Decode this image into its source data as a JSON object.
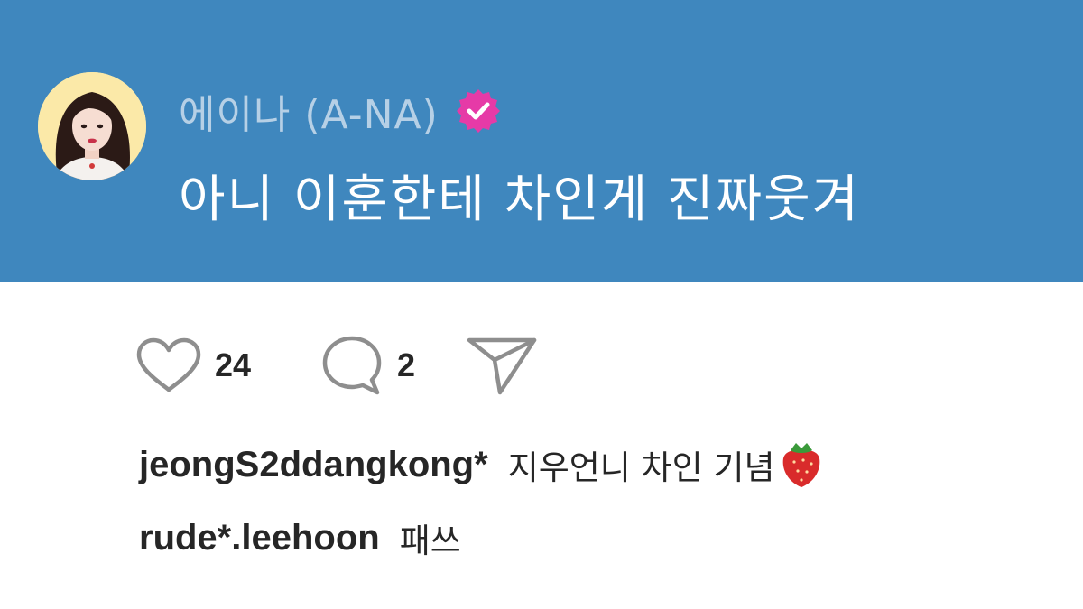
{
  "post": {
    "author": "에이나 (A-NA)",
    "text": "아니 이훈한테 차인게 진짜웃겨"
  },
  "actions": {
    "likes": "24",
    "comments": "2"
  },
  "comments": [
    {
      "user": "jeongS2ddangkong*",
      "text": "지우언니 차인 기념",
      "emoji": "strawberry-emoji"
    },
    {
      "user": "rude*.leehoon",
      "text": "패쓰"
    }
  ],
  "colors": {
    "header_bg": "#3f87be",
    "author_name": "#b6d0e6",
    "verified_badge": "#e63aa7",
    "text_dark": "#262626"
  }
}
